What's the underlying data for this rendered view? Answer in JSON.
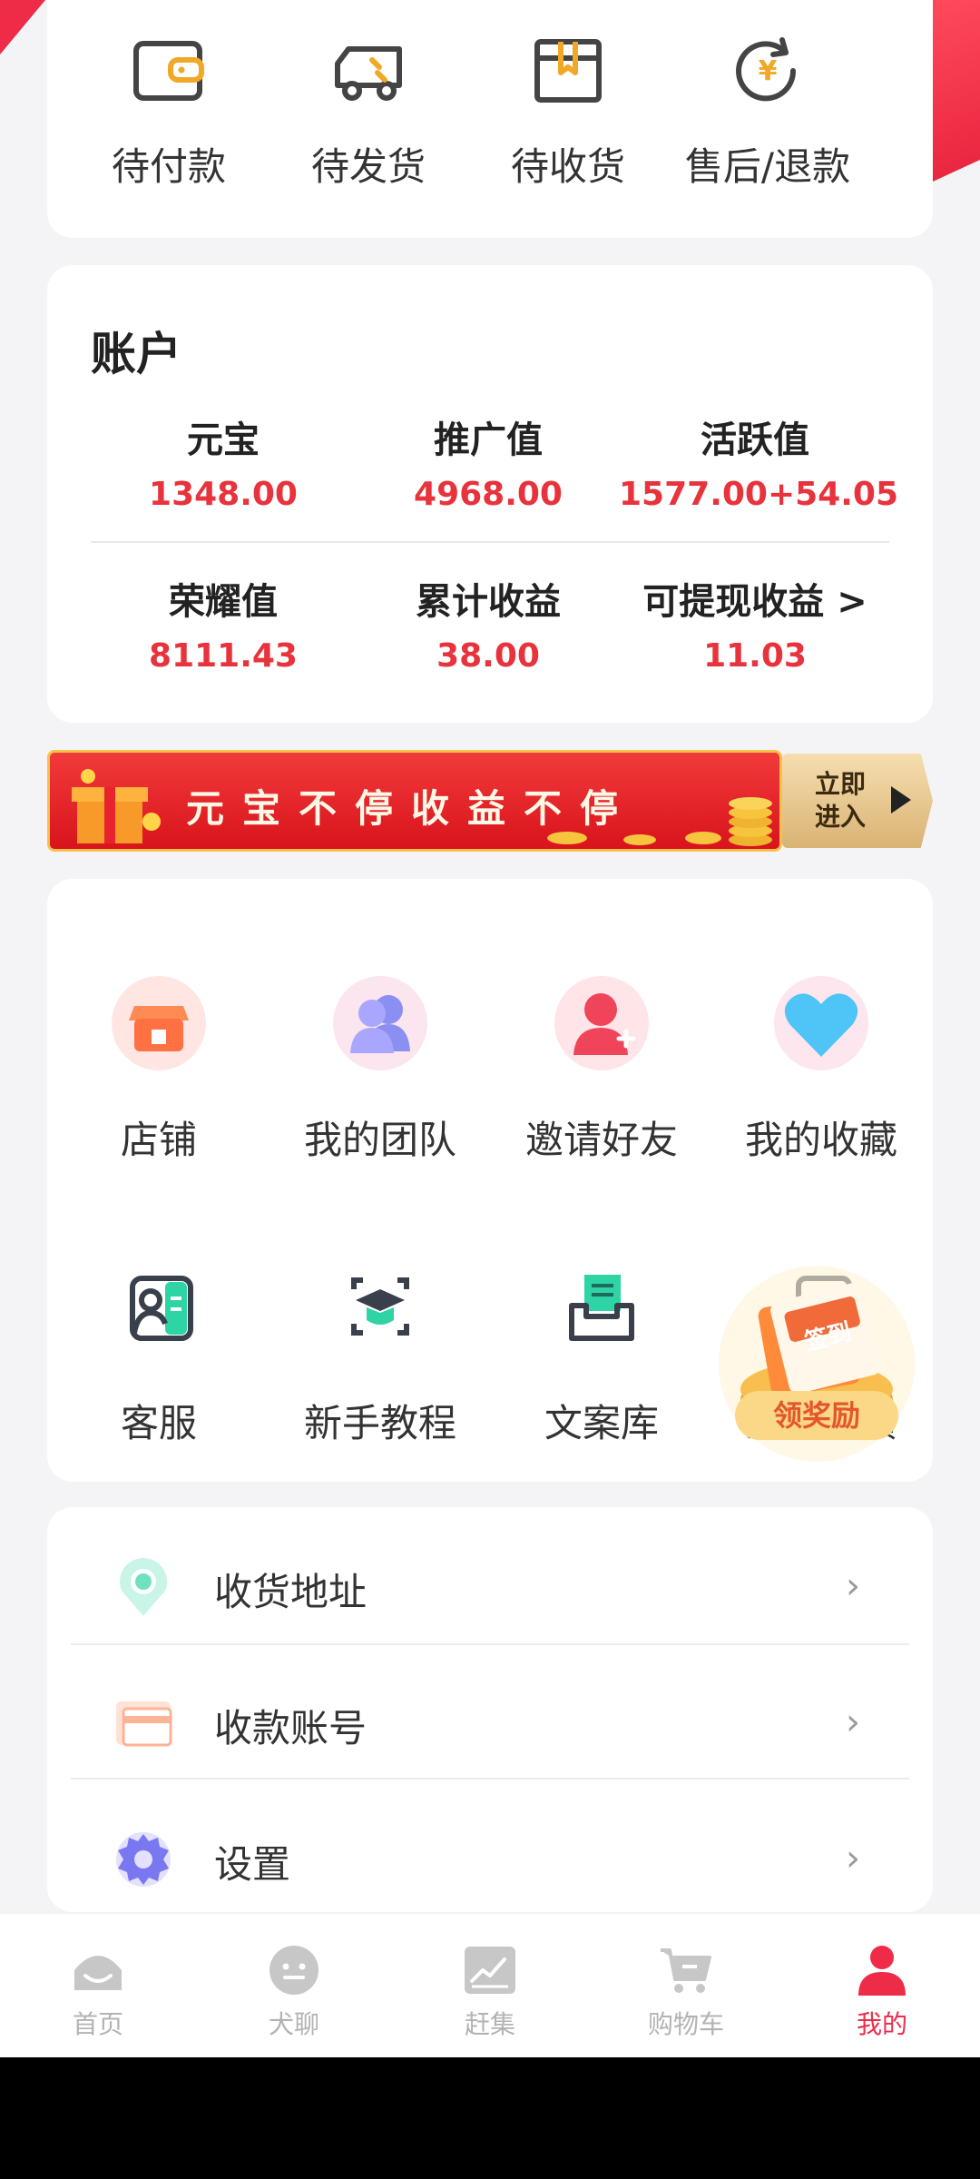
{
  "orders": {
    "items": [
      {
        "label": "待付款",
        "icon": "wallet-icon"
      },
      {
        "label": "待发货",
        "icon": "truck-icon"
      },
      {
        "label": "待收货",
        "icon": "package-icon"
      },
      {
        "label": "售后/退款",
        "icon": "refund-icon"
      }
    ]
  },
  "account": {
    "title": "账户",
    "stats": [
      {
        "label": "元宝",
        "value": "1348.00"
      },
      {
        "label": "推广值",
        "value": "4968.00"
      },
      {
        "label": "活跃值",
        "value": "1577.00+54.05"
      },
      {
        "label": "荣耀值",
        "value": "8111.43"
      },
      {
        "label": "累计收益",
        "value": "38.00"
      },
      {
        "label": "可提现收益 >",
        "value": "11.03"
      }
    ]
  },
  "banner": {
    "text": "元宝不停收益不停",
    "button_line1": "立即",
    "button_line2": "进入"
  },
  "services": {
    "items": [
      {
        "label": "店铺",
        "icon": "shop-icon"
      },
      {
        "label": "我的团队",
        "icon": "team-icon"
      },
      {
        "label": "邀请好友",
        "icon": "invite-friend-icon"
      },
      {
        "label": "我的收藏",
        "icon": "heart-icon"
      },
      {
        "label": "客服",
        "icon": "customer-service-icon"
      },
      {
        "label": "新手教程",
        "icon": "tutorial-icon"
      },
      {
        "label": "文案库",
        "icon": "copy-library-icon"
      },
      {
        "label": "意见反馈",
        "icon": "feedback-icon"
      }
    ],
    "signin_badge": "签到",
    "signin_reward": "领奖励"
  },
  "settings_list": {
    "items": [
      {
        "label": "收货地址",
        "icon": "location-pin-icon"
      },
      {
        "label": "收款账号",
        "icon": "card-icon"
      },
      {
        "label": "设置",
        "icon": "gear-icon"
      }
    ],
    "chevron": "›"
  },
  "tabbar": {
    "tabs": [
      {
        "label": "首页",
        "icon": "home-icon"
      },
      {
        "label": "犬聊",
        "icon": "chat-icon"
      },
      {
        "label": "赶集",
        "icon": "market-icon"
      },
      {
        "label": "购物车",
        "icon": "cart-icon"
      },
      {
        "label": "我的",
        "icon": "profile-icon"
      }
    ],
    "active_index": 4
  },
  "colors": {
    "accent": "#ee2c48",
    "value_red": "#e8323c",
    "background": "#f4f4f6"
  }
}
